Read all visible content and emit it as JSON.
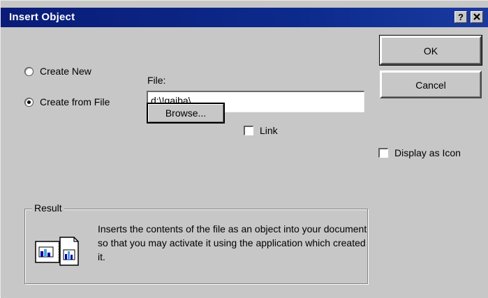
{
  "dialog": {
    "title": "Insert Object",
    "help_button": "?",
    "close_button": "✕"
  },
  "options": {
    "create_new": "Create New",
    "create_from_file": "Create from File",
    "selected": "create_from_file"
  },
  "file": {
    "label": "File:",
    "value": "d:\\!gajba\\"
  },
  "buttons": {
    "ok": "OK",
    "cancel": "Cancel",
    "browse": "Browse..."
  },
  "link": {
    "label": "Link",
    "checked": false
  },
  "display_as_icon": {
    "label": "Display as Icon",
    "checked": false
  },
  "result": {
    "title": "Result",
    "text": "Inserts the contents of the file as an object into your document so that you may activate it using the application which created it."
  },
  "colors": {
    "titlebar": "#0a1c78",
    "face": "#c7c7c7"
  },
  "icons": {
    "result": "result-document-icon"
  }
}
